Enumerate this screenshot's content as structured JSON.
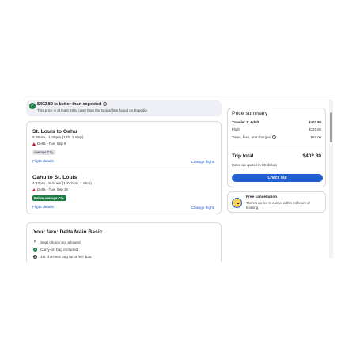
{
  "banner": {
    "title": "$402.80 is better than expected",
    "subtitle": "This price is at least 93% lower than the typical fare found on Expedia"
  },
  "flights": [
    {
      "route": "St. Louis to Oahu",
      "time": "6:30am - 1:30pm (12h, 1 stop)",
      "airline": "Delta • Tue, Sep 9",
      "co2": "Average CO₂",
      "details_link": "Flight details",
      "change_link": "Change flight"
    },
    {
      "route": "Oahu to St. Louis",
      "time": "4:10pm - 8:44am (11h 34m, 1 stop)",
      "airline": "Delta • Tue, Sep 16",
      "co2": "Below average CO₂",
      "details_link": "Flight details",
      "change_link": "Change flight"
    }
  ],
  "fare": {
    "title": "Your fare: Delta Main Basic",
    "items": [
      {
        "icon": "x-icon",
        "text": "Seat choice not allowed"
      },
      {
        "icon": "check-circle-icon",
        "text": "Carry-on bag included"
      },
      {
        "icon": "dollar-circle-icon",
        "text": "1st checked bag for a fee: $35"
      }
    ]
  },
  "summary": {
    "title": "Price summary",
    "traveler_label": "Traveler 1: Adult",
    "traveler_value": "$402.80",
    "flight_label": "Flight",
    "flight_value": "$320.80",
    "taxes_label": "Taxes, fees, and charges",
    "taxes_value": "$82.00",
    "total_label": "Trip total",
    "total_value": "$402.80",
    "note": "Rates are quoted in US dollars",
    "checkout_label": "Check out"
  },
  "cancellation": {
    "title": "Free cancellation",
    "text": "There's no fee to cancel within 24 hours of booking."
  },
  "colors": {
    "accent": "#1f5fd1",
    "success": "#1e7e45",
    "delta_red": "#c8102e"
  }
}
